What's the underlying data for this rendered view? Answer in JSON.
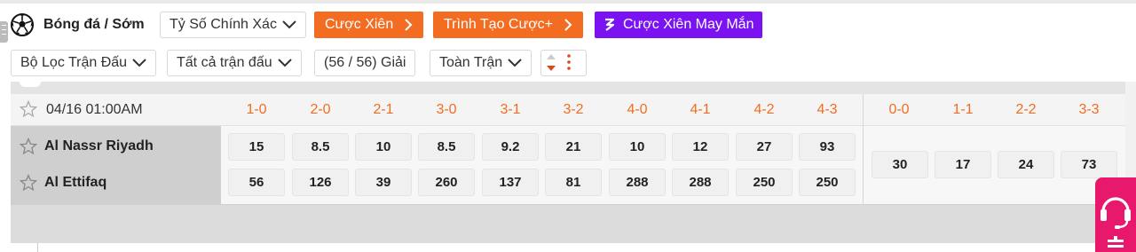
{
  "header": {
    "sport_title": "Bóng đá / Sớm",
    "market_dropdown": "Tỷ Số Chính Xác",
    "buttons": [
      {
        "label": "Cược Xiên"
      },
      {
        "label": "Trình Tạo Cược+"
      },
      {
        "label": "Cược Xiên May Mắn"
      }
    ]
  },
  "filters": {
    "match_filter": "Bộ Lọc Trận Đấu",
    "all_matches": "Tất cả trận đấu",
    "league_count": "(56 / 56) Giải",
    "period": "Toàn Trận"
  },
  "match": {
    "time": "04/16 01:00AM",
    "home": "Al Nassr Riyadh",
    "away": "Al Ettifaq",
    "score_headers": [
      "1-0",
      "2-0",
      "2-1",
      "3-0",
      "3-1",
      "3-2",
      "4-0",
      "4-1",
      "4-2",
      "4-3"
    ],
    "home_odds": [
      "15",
      "8.5",
      "10",
      "8.5",
      "9.2",
      "21",
      "10",
      "12",
      "27",
      "93"
    ],
    "away_odds": [
      "56",
      "126",
      "39",
      "260",
      "137",
      "81",
      "288",
      "288",
      "250",
      "250"
    ],
    "draw_headers": [
      "0-0",
      "1-1",
      "2-2",
      "3-3"
    ],
    "draw_odds": [
      "30",
      "17",
      "24",
      "73"
    ]
  },
  "colors": {
    "orange": "#f26d21",
    "purple": "#7a12f2",
    "support_pink": "#e8186d"
  }
}
